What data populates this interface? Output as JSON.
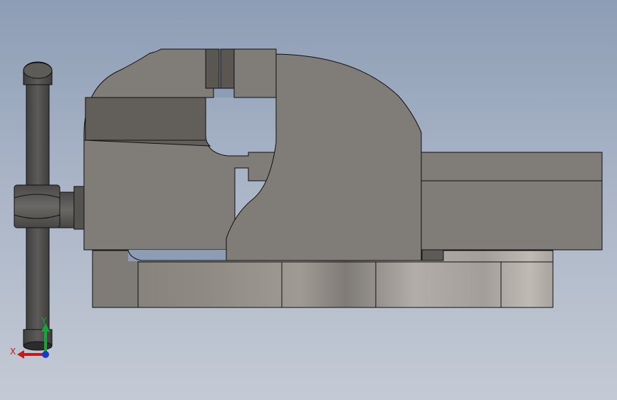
{
  "viewport": {
    "background_top": "#8d9db5",
    "background_bottom": "#c4cad5"
  },
  "model": {
    "part_fill": "#807c77",
    "part_stroke": "#111111"
  },
  "triad": {
    "x_label": "X",
    "y_label": "Y",
    "x_color": "#c41a1a",
    "y_color": "#1aa33a",
    "z_color": "#1a3cc4"
  }
}
